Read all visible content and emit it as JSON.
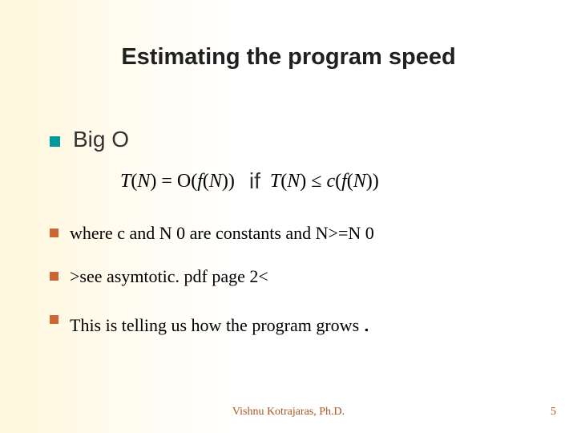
{
  "title": "Estimating the program speed",
  "main_bullet": "Big O",
  "formula": {
    "left": "T(N) = O(f(N))",
    "middle": "if",
    "right": "T(N) ≤ c(f(N))"
  },
  "sub_bullets": [
    "where  c and N 0 are constants and N>=N 0",
    ">see asymtotic. pdf page 2<",
    "This is telling us how the program grows "
  ],
  "footer": "Vishnu Kotrajaras, Ph.D.",
  "page_number": "5"
}
